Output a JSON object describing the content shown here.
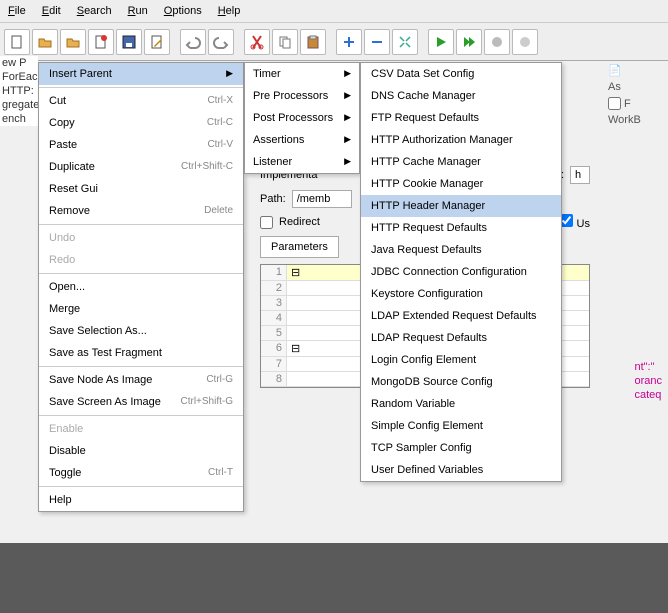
{
  "menubar": [
    "File",
    "Edit",
    "Search",
    "Run",
    "Options",
    "Help"
  ],
  "toolbar_icons": [
    "new-file",
    "open",
    "open-alt",
    "cancel-file",
    "save",
    "edit-doc",
    "",
    "undo",
    "redo",
    "",
    "cut",
    "copy",
    "paste",
    "",
    "plus",
    "minus",
    "wand",
    "",
    "play",
    "play-fwd",
    "stop",
    "clock",
    ""
  ],
  "tree": [
    "ew P",
    "ForEac",
    "HTTP:",
    "gregate",
    "ench"
  ],
  "context": {
    "insert_parent": "Insert Parent",
    "cut": {
      "label": "Cut",
      "key": "Ctrl-X"
    },
    "copy": {
      "label": "Copy",
      "key": "Ctrl-C"
    },
    "paste": {
      "label": "Paste",
      "key": "Ctrl-V"
    },
    "duplicate": {
      "label": "Duplicate",
      "key": "Ctrl+Shift-C"
    },
    "reset_gui": "Reset Gui",
    "remove": {
      "label": "Remove",
      "key": "Delete"
    },
    "undo": "Undo",
    "redo": "Redo",
    "open": "Open...",
    "merge": "Merge",
    "save_sel": "Save Selection As...",
    "save_frag": "Save as Test Fragment",
    "save_node": {
      "label": "Save Node As Image",
      "key": "Ctrl-G"
    },
    "save_screen": {
      "label": "Save Screen As Image",
      "key": "Ctrl+Shift-G"
    },
    "enable": "Enable",
    "disable": "Disable",
    "toggle": {
      "label": "Toggle",
      "key": "Ctrl-T"
    },
    "help": "Help"
  },
  "submenu1": [
    "Timer",
    "Pre Processors",
    "Post Processors",
    "Assertions",
    "Listener"
  ],
  "submenu2": [
    "CSV Data Set Config",
    "DNS Cache Manager",
    "FTP Request Defaults",
    "HTTP Authorization Manager",
    "HTTP Cache Manager",
    "HTTP Cookie Manager",
    "HTTP Header Manager",
    "HTTP Request Defaults",
    "Java Request Defaults",
    "JDBC Connection Configuration",
    "Keystore Configuration",
    "LDAP Extended Request Defaults",
    "LDAP Request Defaults",
    "Login Config Element",
    "MongoDB Source Config",
    "Random Variable",
    "Simple Config Element",
    "TCP Sampler Config",
    "User Defined Variables"
  ],
  "submenu2_highlight_index": 6,
  "panel": {
    "impl_label": "Implementa",
    "pp_label": "p]:",
    "pp_value": "h",
    "path_label": "Path:",
    "path_value": "/memb",
    "redirect_label": "Redirect",
    "us_label": "Us",
    "params_tab": "Parameters"
  },
  "right": {
    "as": "As",
    "f": "F",
    "workb": "WorkB"
  },
  "code": [
    "nt\":\"",
    "oranc",
    "cateq"
  ],
  "grid_rows": [
    1,
    2,
    3,
    4,
    5,
    6,
    7,
    8
  ]
}
